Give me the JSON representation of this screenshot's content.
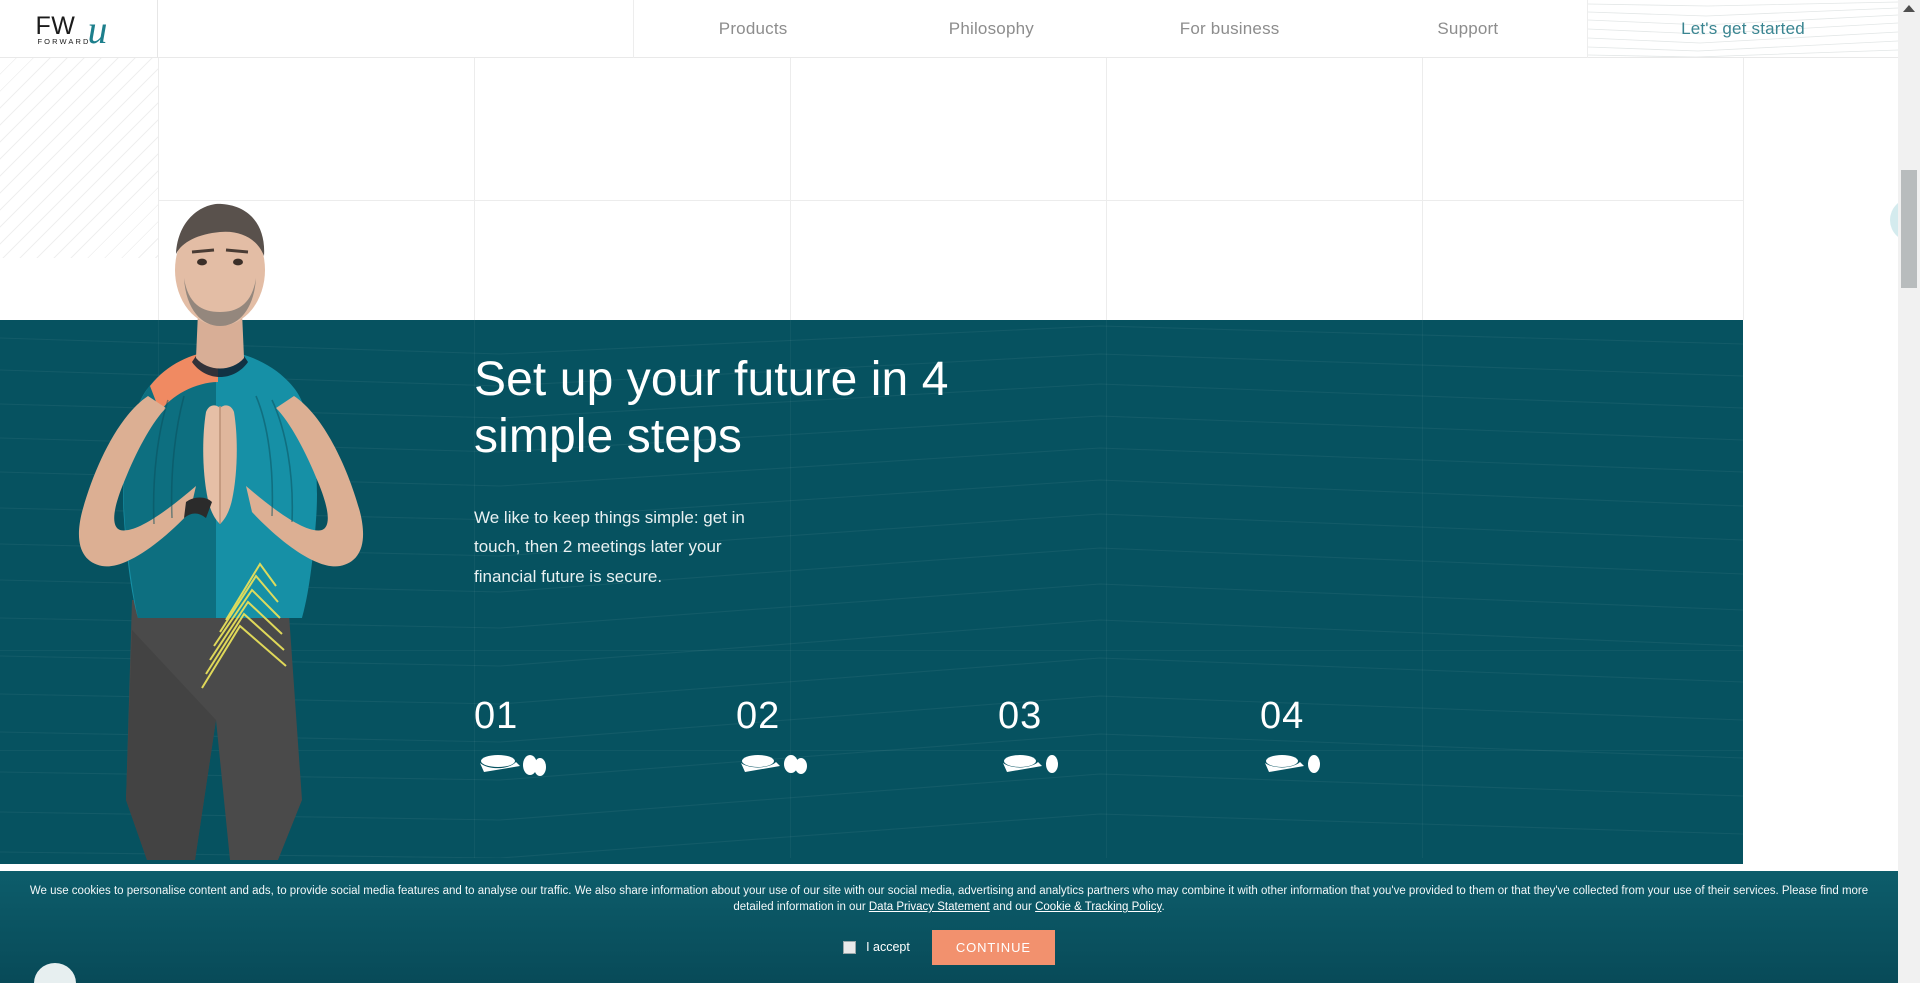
{
  "brand": {
    "logo_primary": "FW",
    "logo_script": "u",
    "logo_tagline": "FORWARD",
    "accent_teal": "#1d7f8c",
    "hero_teal": "#065260",
    "cta_coral": "#f2916e"
  },
  "nav": {
    "items": [
      {
        "label": "Products",
        "name": "nav-item-products"
      },
      {
        "label": "Philosophy",
        "name": "nav-item-philosophy"
      },
      {
        "label": "For business",
        "name": "nav-item-for-business"
      },
      {
        "label": "Support",
        "name": "nav-item-support"
      }
    ],
    "cta_label": "Let's get started"
  },
  "hero": {
    "title": "Set up your future in 4 simple steps",
    "subtitle": "We like to keep things simple: get in touch, then 2 meetings later your financial future is secure.",
    "steps": [
      {
        "number": "01",
        "icon": "handshake-icon"
      },
      {
        "number": "02",
        "icon": "calendar-icon"
      },
      {
        "number": "03",
        "icon": "document-icon"
      },
      {
        "number": "04",
        "icon": "shield-icon"
      }
    ]
  },
  "cookie": {
    "text_part1": "We use cookies to personalise content and ads, to provide social media features and to analyse our traffic. We also share information about your use of our site with our social media, advertising and analytics partners who may combine it with other information that you've provided to them or that they've collected from your use of their services. Please find more detailed information in our ",
    "link1": "Data Privacy Statement",
    "text_part2": " and our ",
    "link2": "Cookie & Tracking Policy",
    "text_part3": ".",
    "accept_label": "I accept",
    "continue_label": "CONTINUE"
  },
  "scrollbar": {
    "up_arrow": "triangle-up-icon"
  }
}
